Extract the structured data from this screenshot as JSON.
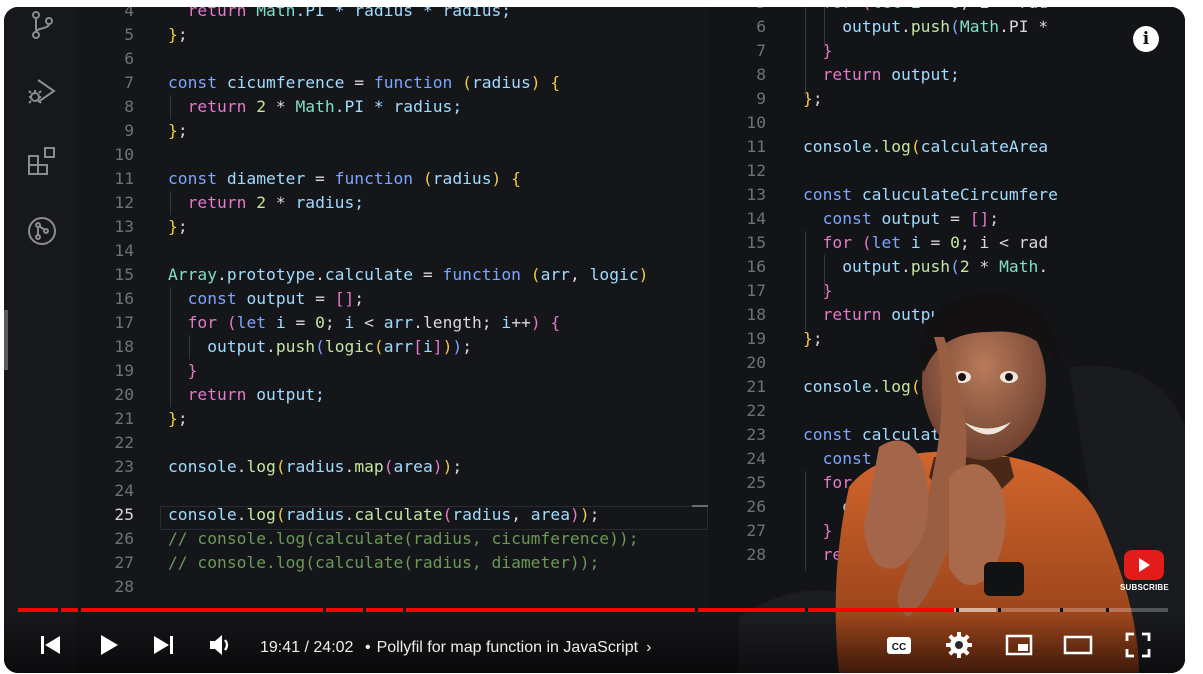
{
  "player": {
    "time_current": "19:41",
    "time_separator": " / ",
    "time_total": "24:02",
    "chapter_title": "Pollyfil for map function in JavaScript",
    "progress_played": 0.814,
    "progress_buffered": 0.85,
    "subscribe_label": "SUBSCRIBE",
    "info_label": "i",
    "colors": {
      "progress": "#ff0000",
      "subscribe": "#e31b1b"
    }
  },
  "activity_bar": {
    "icons": [
      "source-control-icon",
      "run-debug-icon",
      "extensions-icon",
      "remote-icon"
    ]
  },
  "editor_left": {
    "current_line": "25",
    "lines": [
      {
        "n": "4",
        "tokens": [
          [
            "  ",
            "pl"
          ],
          [
            "return ",
            "kw2"
          ],
          [
            "Math",
            "cls"
          ],
          [
            ".PI * radius * radius;",
            "id"
          ]
        ]
      },
      {
        "n": "5",
        "tokens": [
          [
            "}",
            "br1"
          ],
          [
            ";",
            "pl"
          ]
        ]
      },
      {
        "n": "6",
        "tokens": []
      },
      {
        "n": "7",
        "tokens": [
          [
            "const ",
            "kw"
          ],
          [
            "cicumference",
            "id"
          ],
          [
            " = ",
            "pl"
          ],
          [
            "function ",
            "kw"
          ],
          [
            "(",
            "br1"
          ],
          [
            "radius",
            "id"
          ],
          [
            ") ",
            "br1"
          ],
          [
            "{",
            "br1"
          ]
        ]
      },
      {
        "n": "8",
        "tokens": [
          [
            "  ",
            "pl"
          ],
          [
            "return ",
            "kw2"
          ],
          [
            "2",
            "num"
          ],
          [
            " * ",
            "pl"
          ],
          [
            "Math",
            "cls"
          ],
          [
            ".PI * radius;",
            "id"
          ]
        ]
      },
      {
        "n": "9",
        "tokens": [
          [
            "}",
            "br1"
          ],
          [
            ";",
            "pl"
          ]
        ]
      },
      {
        "n": "10",
        "tokens": []
      },
      {
        "n": "11",
        "tokens": [
          [
            "const ",
            "kw"
          ],
          [
            "diameter",
            "id"
          ],
          [
            " = ",
            "pl"
          ],
          [
            "function ",
            "kw"
          ],
          [
            "(",
            "br1"
          ],
          [
            "radius",
            "id"
          ],
          [
            ") ",
            "br1"
          ],
          [
            "{",
            "br1"
          ]
        ]
      },
      {
        "n": "12",
        "tokens": [
          [
            "  ",
            "pl"
          ],
          [
            "return ",
            "kw2"
          ],
          [
            "2",
            "num"
          ],
          [
            " * ",
            "pl"
          ],
          [
            "radius;",
            "id"
          ]
        ]
      },
      {
        "n": "13",
        "tokens": [
          [
            "}",
            "br1"
          ],
          [
            ";",
            "pl"
          ]
        ]
      },
      {
        "n": "14",
        "tokens": []
      },
      {
        "n": "15",
        "tokens": [
          [
            "Array",
            "cls"
          ],
          [
            ".",
            "pl"
          ],
          [
            "prototype",
            "id"
          ],
          [
            ".",
            "pl"
          ],
          [
            "calculate",
            "id"
          ],
          [
            " = ",
            "pl"
          ],
          [
            "function ",
            "kw"
          ],
          [
            "(",
            "br1"
          ],
          [
            "arr",
            "id"
          ],
          [
            ", ",
            "pl"
          ],
          [
            "logic",
            "id"
          ],
          [
            ")",
            "br1"
          ]
        ]
      },
      {
        "n": "16",
        "tokens": [
          [
            "  ",
            "pl"
          ],
          [
            "const ",
            "kw"
          ],
          [
            "output",
            "id"
          ],
          [
            " = ",
            "pl"
          ],
          [
            "[]",
            "br2"
          ],
          [
            ";",
            "pl"
          ]
        ]
      },
      {
        "n": "17",
        "tokens": [
          [
            "  ",
            "pl"
          ],
          [
            "for ",
            "kw2"
          ],
          [
            "(",
            "br2"
          ],
          [
            "let ",
            "kw"
          ],
          [
            "i",
            "id"
          ],
          [
            " = ",
            "pl"
          ],
          [
            "0",
            "num"
          ],
          [
            "; ",
            "pl"
          ],
          [
            "i",
            "id"
          ],
          [
            " < ",
            "pl"
          ],
          [
            "arr",
            "id"
          ],
          [
            ".length; ",
            "pl"
          ],
          [
            "i",
            "id"
          ],
          [
            "++",
            "pl"
          ],
          [
            ") ",
            "br2"
          ],
          [
            "{",
            "br2"
          ]
        ]
      },
      {
        "n": "18",
        "tokens": [
          [
            "    ",
            "pl"
          ],
          [
            "output",
            "id"
          ],
          [
            ".",
            "pl"
          ],
          [
            "push",
            "fn"
          ],
          [
            "(",
            "br3"
          ],
          [
            "logic",
            "fn"
          ],
          [
            "(",
            "br1"
          ],
          [
            "arr",
            "id"
          ],
          [
            "[",
            "br2"
          ],
          [
            "i",
            "id"
          ],
          [
            "]",
            "br2"
          ],
          [
            ")",
            "br1"
          ],
          [
            ")",
            "br3"
          ],
          [
            ";",
            "pl"
          ]
        ]
      },
      {
        "n": "19",
        "tokens": [
          [
            "  ",
            "pl"
          ],
          [
            "}",
            "br2"
          ]
        ]
      },
      {
        "n": "20",
        "tokens": [
          [
            "  ",
            "pl"
          ],
          [
            "return ",
            "kw2"
          ],
          [
            "output;",
            "id"
          ]
        ]
      },
      {
        "n": "21",
        "tokens": [
          [
            "}",
            "br1"
          ],
          [
            ";",
            "pl"
          ]
        ]
      },
      {
        "n": "22",
        "tokens": []
      },
      {
        "n": "23",
        "tokens": [
          [
            "console",
            "id"
          ],
          [
            ".",
            "pl"
          ],
          [
            "log",
            "fn"
          ],
          [
            "(",
            "br1"
          ],
          [
            "radius",
            "id"
          ],
          [
            ".",
            "pl"
          ],
          [
            "map",
            "fn"
          ],
          [
            "(",
            "br2"
          ],
          [
            "area",
            "id"
          ],
          [
            ")",
            "br2"
          ],
          [
            ")",
            "br1"
          ],
          [
            ";",
            "pl"
          ]
        ]
      },
      {
        "n": "24",
        "tokens": []
      },
      {
        "n": "25",
        "tokens": [
          [
            "console",
            "id"
          ],
          [
            ".",
            "pl"
          ],
          [
            "log",
            "fn"
          ],
          [
            "(",
            "br1"
          ],
          [
            "radius",
            "id"
          ],
          [
            ".",
            "pl"
          ],
          [
            "calculate",
            "fn"
          ],
          [
            "(",
            "br2"
          ],
          [
            "radius",
            "id"
          ],
          [
            ", ",
            "pl"
          ],
          [
            "area",
            "id"
          ],
          [
            ")",
            "br2"
          ],
          [
            ")",
            "br1"
          ],
          [
            ";",
            "pl"
          ]
        ]
      },
      {
        "n": "26",
        "tokens": [
          [
            "// console.log(calculate(radius, cicumference));",
            "cm"
          ]
        ]
      },
      {
        "n": "27",
        "tokens": [
          [
            "// console.log(calculate(radius, diameter));",
            "cm"
          ]
        ]
      },
      {
        "n": "28",
        "tokens": []
      }
    ]
  },
  "editor_right": {
    "lines": [
      {
        "n": "5",
        "tokens": [
          [
            "  ",
            "pl"
          ],
          [
            "for ",
            "kw2"
          ],
          [
            "(",
            "br2"
          ],
          [
            "let ",
            "kw"
          ],
          [
            "i",
            "id"
          ],
          [
            " = ",
            "pl"
          ],
          [
            "0",
            "num"
          ],
          [
            "; i < rad",
            "pl"
          ]
        ]
      },
      {
        "n": "6",
        "tokens": [
          [
            "    ",
            "pl"
          ],
          [
            "output",
            "id"
          ],
          [
            ".",
            "pl"
          ],
          [
            "push",
            "fn"
          ],
          [
            "(",
            "br3"
          ],
          [
            "Math",
            "cls"
          ],
          [
            ".PI *",
            "pl"
          ]
        ]
      },
      {
        "n": "7",
        "tokens": [
          [
            "  ",
            "pl"
          ],
          [
            "}",
            "br2"
          ]
        ]
      },
      {
        "n": "8",
        "tokens": [
          [
            "  ",
            "pl"
          ],
          [
            "return ",
            "kw2"
          ],
          [
            "output;",
            "id"
          ]
        ]
      },
      {
        "n": "9",
        "tokens": [
          [
            "}",
            "br1"
          ],
          [
            ";",
            "pl"
          ]
        ]
      },
      {
        "n": "10",
        "tokens": []
      },
      {
        "n": "11",
        "tokens": [
          [
            "console",
            "id"
          ],
          [
            ".",
            "pl"
          ],
          [
            "log",
            "fn"
          ],
          [
            "(",
            "br1"
          ],
          [
            "calculateArea",
            "id"
          ]
        ]
      },
      {
        "n": "12",
        "tokens": []
      },
      {
        "n": "13",
        "tokens": [
          [
            "const ",
            "kw"
          ],
          [
            "caluculateCircumfere",
            "id"
          ]
        ]
      },
      {
        "n": "14",
        "tokens": [
          [
            "  ",
            "pl"
          ],
          [
            "const ",
            "kw"
          ],
          [
            "output",
            "id"
          ],
          [
            " = ",
            "pl"
          ],
          [
            "[]",
            "br2"
          ],
          [
            ";",
            "pl"
          ]
        ]
      },
      {
        "n": "15",
        "tokens": [
          [
            "  ",
            "pl"
          ],
          [
            "for ",
            "kw2"
          ],
          [
            "(",
            "br2"
          ],
          [
            "let ",
            "kw"
          ],
          [
            "i",
            "id"
          ],
          [
            " = ",
            "pl"
          ],
          [
            "0",
            "num"
          ],
          [
            "; i < rad",
            "pl"
          ]
        ]
      },
      {
        "n": "16",
        "tokens": [
          [
            "    ",
            "pl"
          ],
          [
            "output",
            "id"
          ],
          [
            ".",
            "pl"
          ],
          [
            "push",
            "fn"
          ],
          [
            "(",
            "br3"
          ],
          [
            "2",
            "num"
          ],
          [
            " * ",
            "pl"
          ],
          [
            "Math",
            "cls"
          ],
          [
            ".",
            "pl"
          ]
        ]
      },
      {
        "n": "17",
        "tokens": [
          [
            "  ",
            "pl"
          ],
          [
            "}",
            "br2"
          ]
        ]
      },
      {
        "n": "18",
        "tokens": [
          [
            "  ",
            "pl"
          ],
          [
            "return ",
            "kw2"
          ],
          [
            "output",
            "id"
          ]
        ]
      },
      {
        "n": "19",
        "tokens": [
          [
            "}",
            "br1"
          ],
          [
            ";",
            "pl"
          ]
        ]
      },
      {
        "n": "20",
        "tokens": []
      },
      {
        "n": "21",
        "tokens": [
          [
            "console",
            "id"
          ],
          [
            ".",
            "pl"
          ],
          [
            "log",
            "fn"
          ],
          [
            "(",
            "br1"
          ],
          [
            "calcu",
            "id"
          ]
        ]
      },
      {
        "n": "22",
        "tokens": []
      },
      {
        "n": "23",
        "tokens": [
          [
            "const ",
            "kw"
          ],
          [
            "calculat",
            "id"
          ]
        ]
      },
      {
        "n": "24",
        "tokens": [
          [
            "  ",
            "pl"
          ],
          [
            "const ",
            "kw"
          ],
          [
            "o",
            "id"
          ]
        ]
      },
      {
        "n": "25",
        "tokens": [
          [
            "  ",
            "pl"
          ],
          [
            "for ",
            "kw2"
          ],
          [
            "(l",
            "pl"
          ]
        ]
      },
      {
        "n": "26",
        "tokens": [
          [
            "    ",
            "pl"
          ],
          [
            "outp",
            "id"
          ]
        ]
      },
      {
        "n": "27",
        "tokens": [
          [
            "  ",
            "pl"
          ],
          [
            "}",
            "br2"
          ]
        ]
      },
      {
        "n": "28",
        "tokens": [
          [
            "  ",
            "pl"
          ],
          [
            "retu",
            "kw2"
          ]
        ]
      }
    ]
  }
}
